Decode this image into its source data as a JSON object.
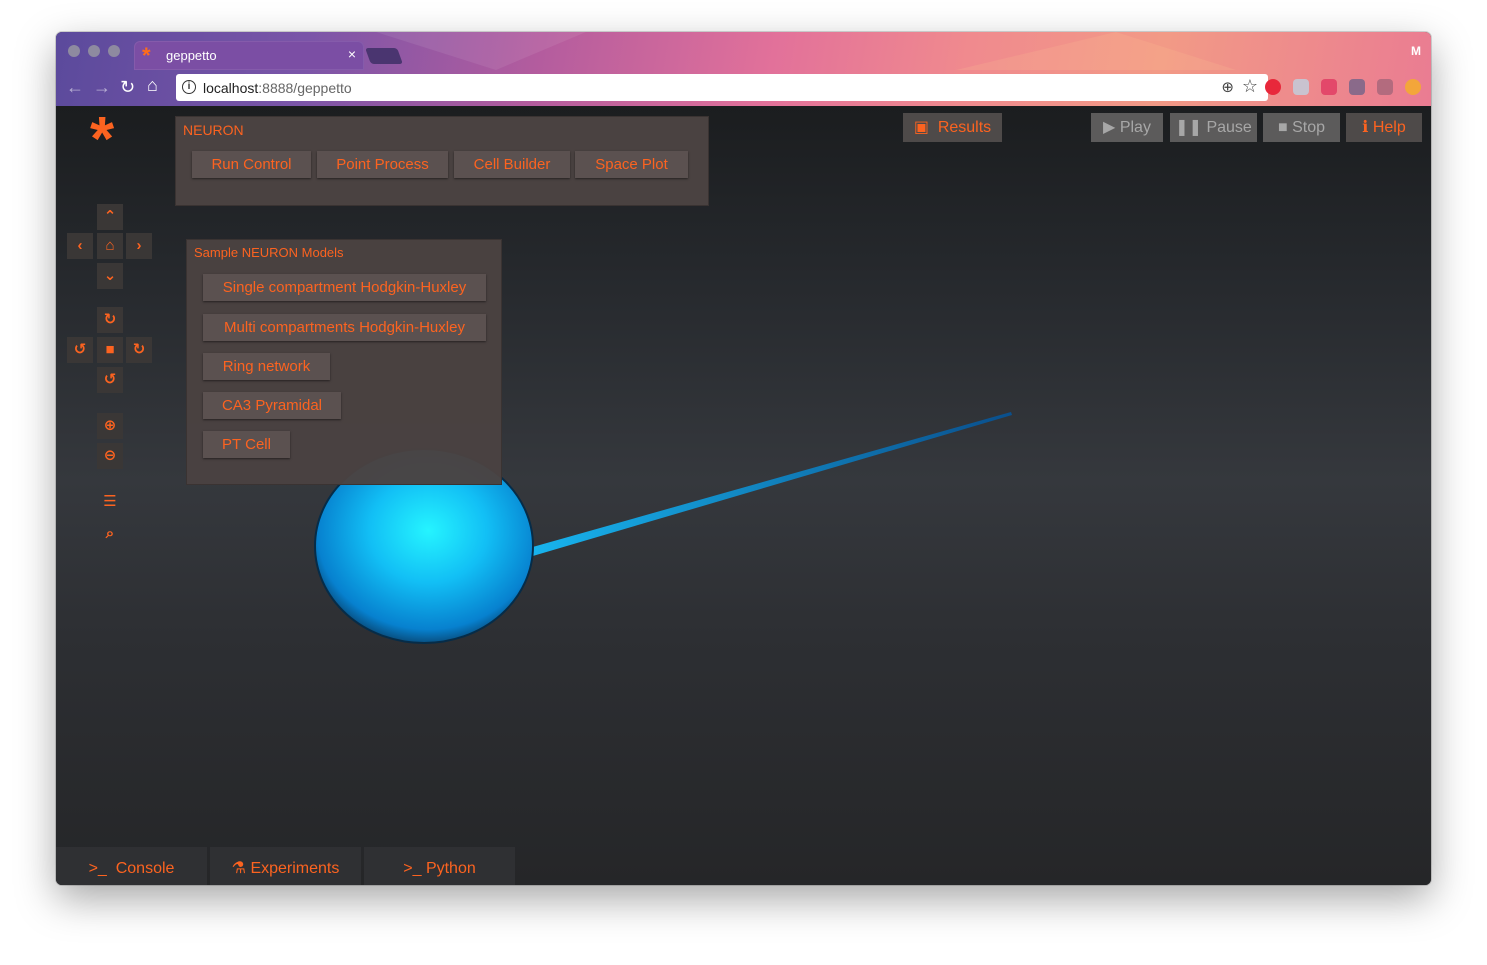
{
  "browser": {
    "tab_title": "geppetto",
    "tab_close": "×",
    "profile_initial": "M",
    "url_host": "localhost",
    "url_rest": ":8888/geppetto"
  },
  "toolbar": {
    "neuron_title": "NEURON",
    "buttons": [
      "Run Control",
      "Point Process",
      "Cell Builder",
      "Space Plot"
    ]
  },
  "samples": {
    "title": "Sample NEURON Models",
    "items": [
      "Single compartment Hodgkin-Huxley",
      "Multi compartments Hodgkin-Huxley",
      "Ring network",
      "CA3 Pyramidal",
      "PT Cell"
    ]
  },
  "top_controls": {
    "results": "Results",
    "play": "Play",
    "pause": "Pause",
    "stop": "Stop",
    "help": "Help"
  },
  "bottom_tabs": {
    "console": "Console",
    "experiments": "Experiments",
    "python": "Python"
  },
  "colors": {
    "accent": "#fc6320",
    "panel": "#4a4241",
    "soma": "#1fd7ff",
    "neurite": "#0b84d8"
  }
}
